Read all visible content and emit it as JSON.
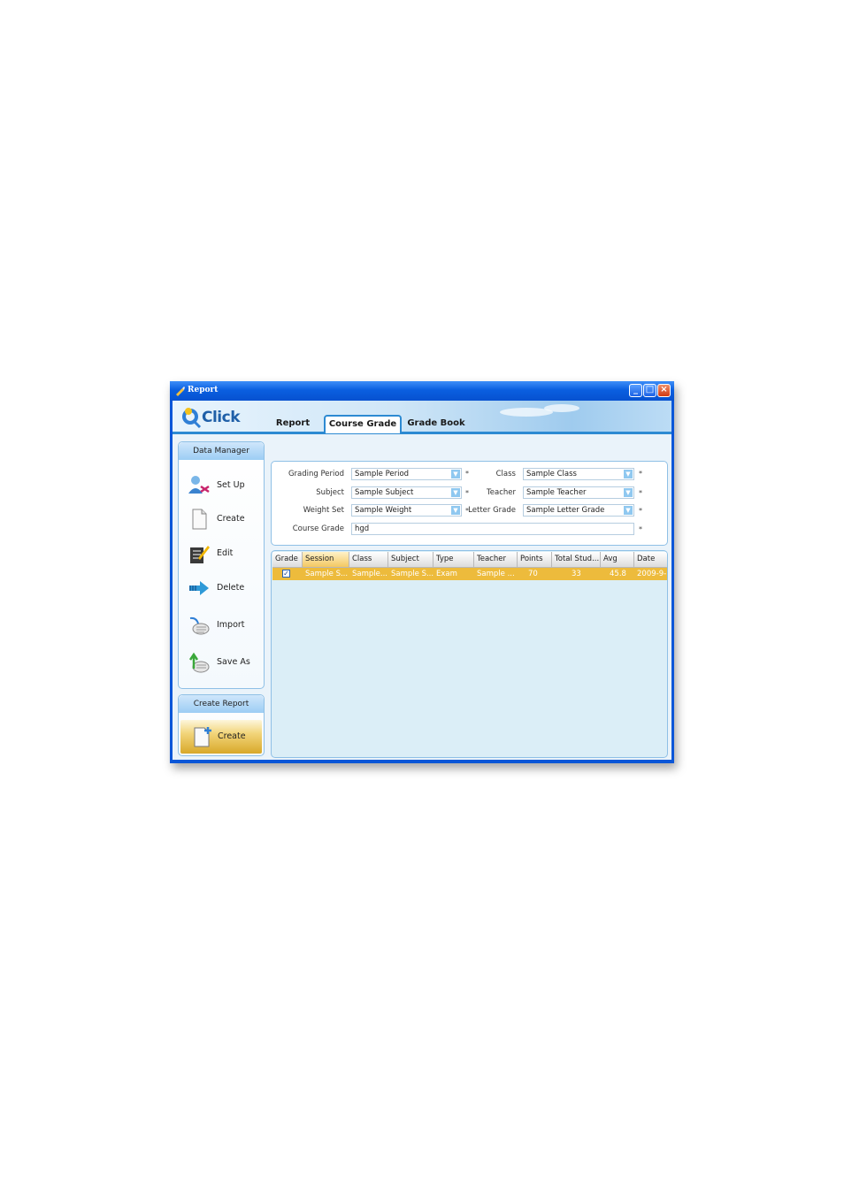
{
  "window": {
    "title": "Report"
  },
  "logo": {
    "text": "Click"
  },
  "tabs": [
    {
      "label": "Report"
    },
    {
      "label": "Course Grade",
      "active": true
    },
    {
      "label": "Grade Book"
    }
  ],
  "sidebar": {
    "data_manager": {
      "header": "Data Manager",
      "items": [
        {
          "label": "Set Up",
          "icon": "users-setup-icon"
        },
        {
          "label": "Create",
          "icon": "blank-document-icon"
        },
        {
          "label": "Edit",
          "icon": "edit-pencil-icon"
        },
        {
          "label": "Delete",
          "icon": "arrow-right-icon"
        },
        {
          "label": "Import",
          "icon": "import-icon"
        },
        {
          "label": "Save As",
          "icon": "save-as-icon"
        }
      ]
    },
    "create_report": {
      "header": "Create Report",
      "button_label": "Create",
      "icon": "new-document-icon"
    }
  },
  "form": {
    "grading_period": {
      "label": "Grading Period",
      "value": "Sample Period",
      "required": "*"
    },
    "subject": {
      "label": "Subject",
      "value": "Sample Subject",
      "required": "*"
    },
    "weight_set": {
      "label": "Weight Set",
      "value": "Sample Weight",
      "required": "*"
    },
    "class": {
      "label": "Class",
      "value": "Sample Class",
      "required": "*"
    },
    "teacher": {
      "label": "Teacher",
      "value": "Sample Teacher",
      "required": "*"
    },
    "letter_grade": {
      "label": "Letter Grade",
      "value": "Sample Letter Grade",
      "required": "*"
    },
    "course_grade": {
      "label": "Course Grade",
      "value": "hgd",
      "required": "*"
    }
  },
  "grid": {
    "columns": [
      "Grade",
      "Session",
      "Class",
      "Subject",
      "Type",
      "Teacher",
      "Points",
      "Total Stud...",
      "Avg",
      "Date"
    ],
    "rows": [
      {
        "grade_checked": "✓",
        "session": "Sample S...",
        "class": "Sample...",
        "subject": "Sample S...",
        "type": "Exam",
        "teacher": "Sample ...",
        "points": "70",
        "total_students": "33",
        "avg": "45.8",
        "date": "2009-9-"
      }
    ]
  },
  "colors": {
    "titlebar": "#0a5fe0",
    "selected_row": "#edbb3c",
    "panel_border": "#8fc0e6"
  }
}
